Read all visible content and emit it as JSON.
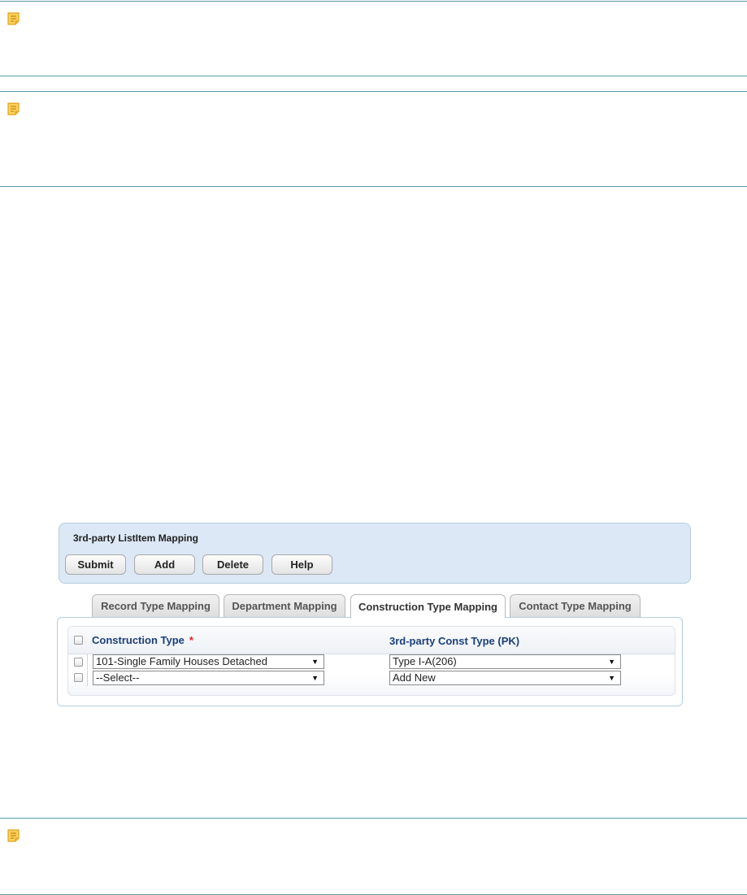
{
  "notes": [
    {
      "icon": "note-icon"
    },
    {
      "icon": "note-icon"
    },
    {
      "icon": "note-icon"
    }
  ],
  "panel": {
    "title": "3rd-party ListItem Mapping",
    "buttons": {
      "submit": "Submit",
      "add": "Add",
      "delete": "Delete",
      "help": "Help"
    }
  },
  "tabs": {
    "record": "Record Type Mapping",
    "department": "Department Mapping",
    "construction": "Construction Type Mapping",
    "contact": "Contact Type Mapping",
    "active": "construction"
  },
  "grid": {
    "headers": {
      "construction_type": "Construction Type",
      "required_mark": "*",
      "third_party": "3rd-party Const Type (PK)"
    },
    "rows": [
      {
        "construction_type": "101-Single Family Houses Detached",
        "third_party": "Type I-A(206)"
      },
      {
        "construction_type": "--Select--",
        "third_party": "Add New"
      }
    ]
  },
  "colors": {
    "panel_bg": "#dce8f5",
    "header_text": "#1b3f7a",
    "required": "#d22222",
    "note_icon": "#f0b428"
  }
}
